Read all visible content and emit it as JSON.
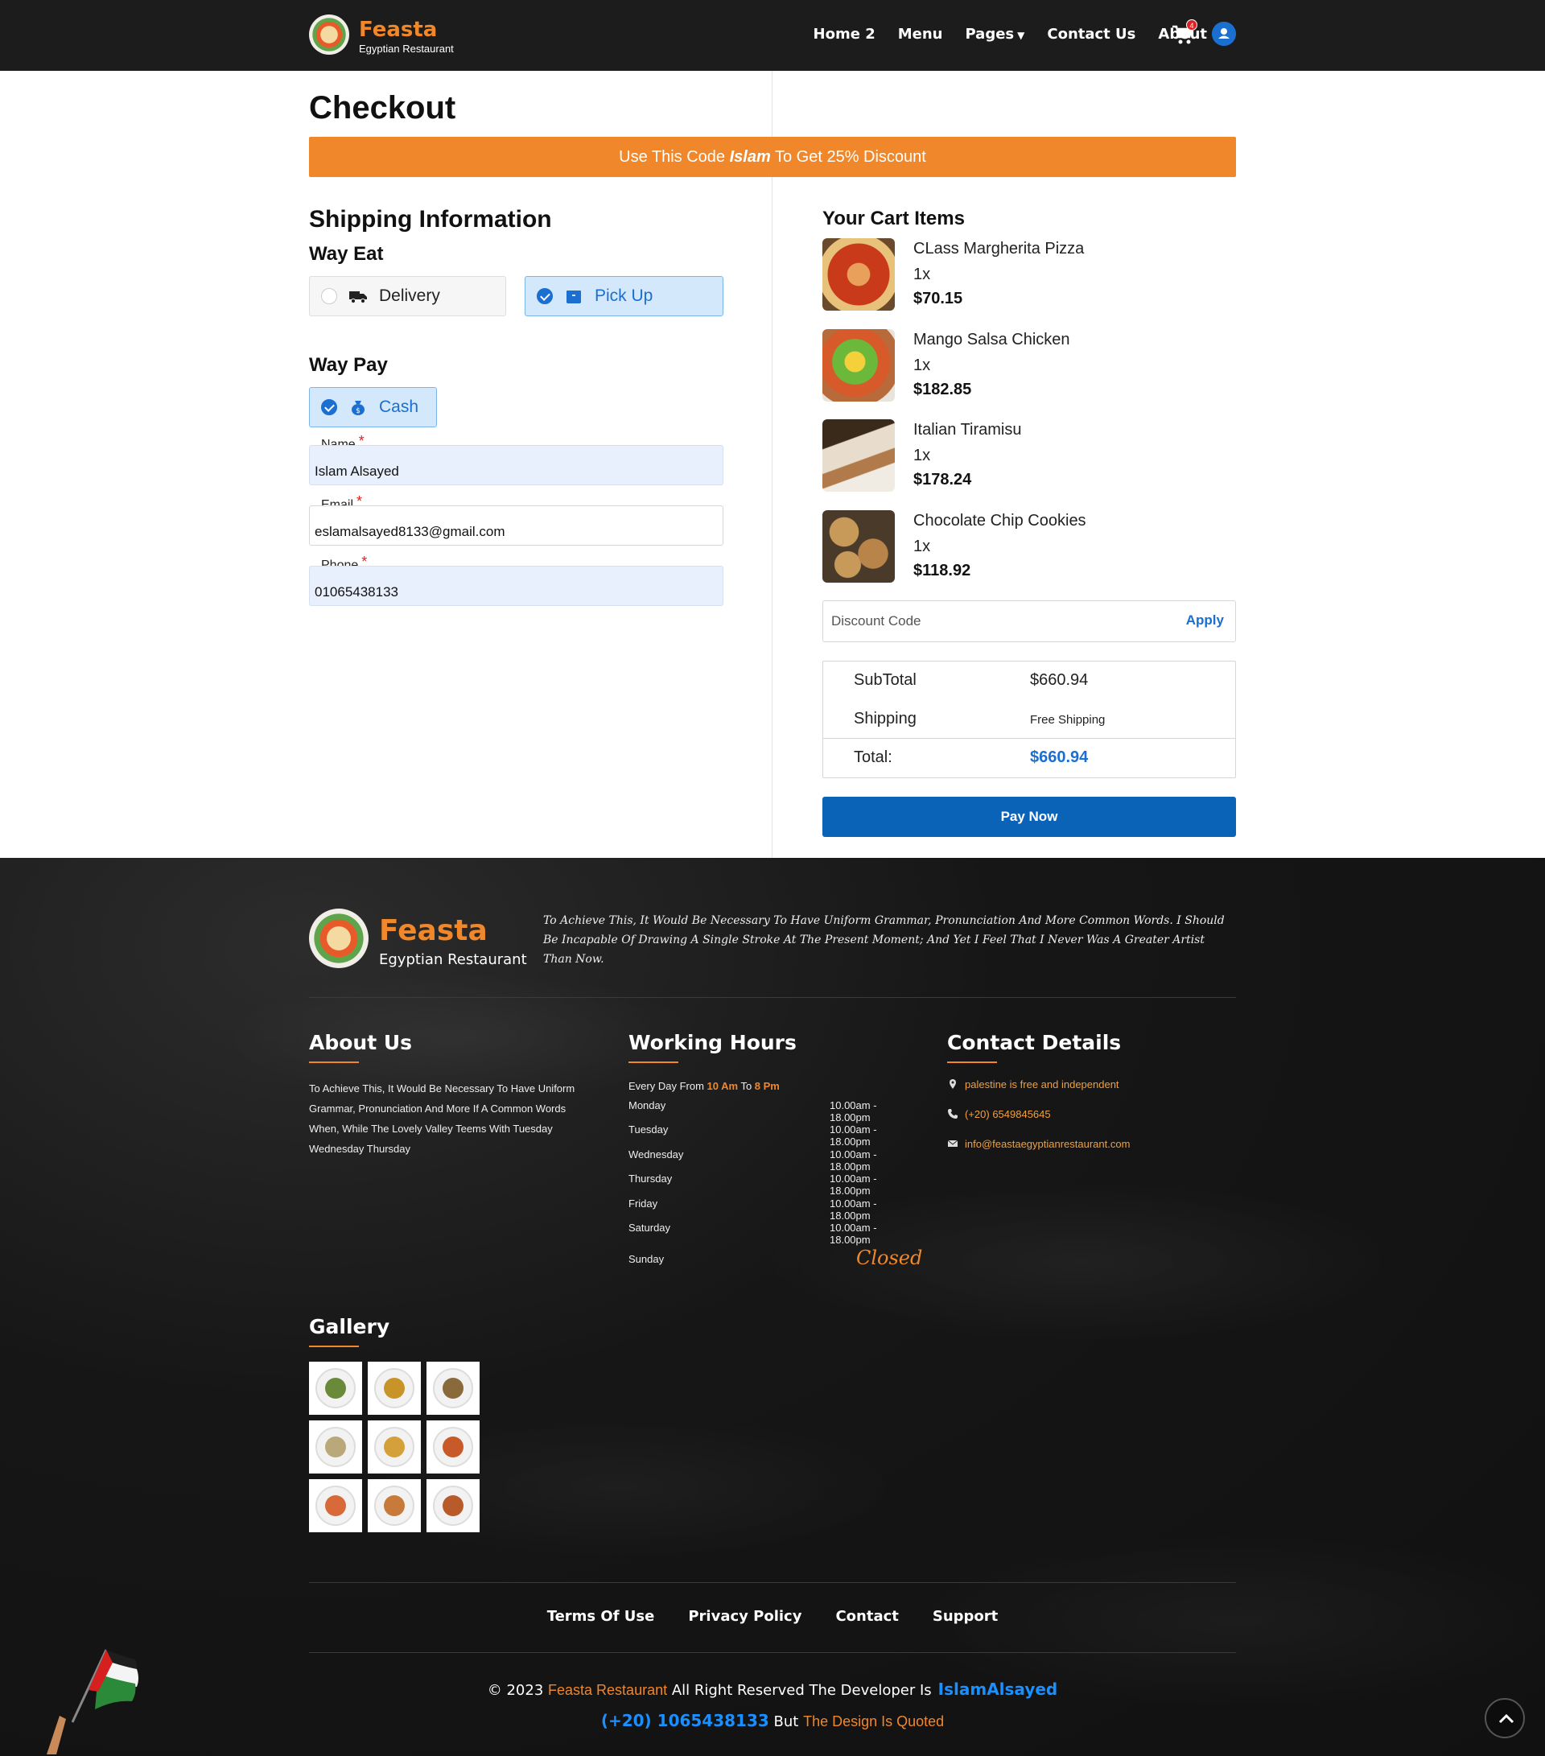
{
  "nav": {
    "brand": "Feasta",
    "brand_sub": "Egyptian Restaurant",
    "links": [
      "Home 2",
      "Menu",
      "Pages",
      "Contact Us",
      "About"
    ],
    "cart_count": "4"
  },
  "checkout": {
    "title": "Checkout",
    "promo_before": "Use This Code ",
    "promo_code": "Islam",
    "promo_after": " To Get 25% Discount",
    "shipping_title": "Shipping Information",
    "way_eat_title": "Way Eat",
    "way_eat_options": [
      {
        "label": "Delivery",
        "icon": "truck-icon",
        "selected": false
      },
      {
        "label": "Pick Up",
        "icon": "box-icon",
        "selected": true
      }
    ],
    "way_pay_title": "Way Pay",
    "way_pay_options": [
      {
        "label": "Cash",
        "icon": "money-bag-icon",
        "selected": true
      }
    ],
    "fields": {
      "name": {
        "label": "Name",
        "value": "Islam Alsayed"
      },
      "email": {
        "label": "Email",
        "value": "eslamalsayed8133@gmail.com"
      },
      "phone": {
        "label": "Phone",
        "value": "01065438133"
      }
    }
  },
  "cart": {
    "title": "Your Cart Items",
    "items": [
      {
        "name": "CLass Margherita Pizza",
        "qty": "1x",
        "price": "$70.15"
      },
      {
        "name": "Mango Salsa Chicken",
        "qty": "1x",
        "price": "$182.85"
      },
      {
        "name": "Italian Tiramisu",
        "qty": "1x",
        "price": "$178.24"
      },
      {
        "name": "Chocolate Chip Cookies",
        "qty": "1x",
        "price": "$118.92"
      }
    ],
    "discount_placeholder": "Discount Code",
    "apply_label": "Apply",
    "subtotal_label": "SubTotal",
    "subtotal_value": "$660.94",
    "shipping_label": "Shipping",
    "shipping_value": "Free Shipping",
    "total_label": "Total:",
    "total_value": "$660.94",
    "pay_label": "Pay Now"
  },
  "footer": {
    "brand": "Feasta",
    "brand_sub": "Egyptian Restaurant",
    "description": "To Achieve This, It Would Be Necessary To Have Uniform Grammar, Pronunciation And More Common Words. I Should Be Incapable Of Drawing A Single Stroke At The Present Moment; And Yet I Feel That I Never Was A Greater Artist Than Now.",
    "about_title": "About Us",
    "about_text": "To Achieve This, It Would Be Necessary To Have Uniform Grammar, Pronunciation And More If A Common Words When, While The Lovely Valley Teems With Tuesday Wednesday Thursday",
    "hours_title": "Working Hours",
    "hours_intro_a": "Every Day From ",
    "hours_intro_from": "10 Am",
    "hours_intro_b": " To ",
    "hours_intro_to": "8 Pm",
    "hours": [
      {
        "day": "Monday",
        "time": "10.00am - 18.00pm"
      },
      {
        "day": "Tuesday",
        "time": "10.00am - 18.00pm"
      },
      {
        "day": "Wednesday",
        "time": "10.00am - 18.00pm"
      },
      {
        "day": "Thursday",
        "time": "10.00am - 18.00pm"
      },
      {
        "day": "Friday",
        "time": "10.00am - 18.00pm"
      },
      {
        "day": "Saturday",
        "time": "10.00am - 18.00pm"
      },
      {
        "day": "Sunday",
        "time": ""
      }
    ],
    "closed_label": "Closed",
    "contact_title": "Contact Details",
    "contact": {
      "address": "palestine is free and independent",
      "phone": "(+20) 6549845645",
      "email": "info@feastaegyptianrestaurant.com"
    },
    "gallery_title": "Gallery",
    "links": [
      "Terms Of Use",
      "Privacy Policy",
      "Contact",
      "Support"
    ],
    "copyright_a": "© 2023 ",
    "copyright_brand": "Feasta Restaurant",
    "copyright_b": " All Right Reserved The Developer Is",
    "developer": "IslamAlsayed",
    "dev_phone": "(+20) 1065438133",
    "but": " But ",
    "quoted": "The Design Is Quoted"
  },
  "colors": {
    "accent": "#f0872a",
    "primary_blue": "#1a6fd1",
    "pay_button": "#0b63b8",
    "nav_bg": "#1c1c1c"
  }
}
